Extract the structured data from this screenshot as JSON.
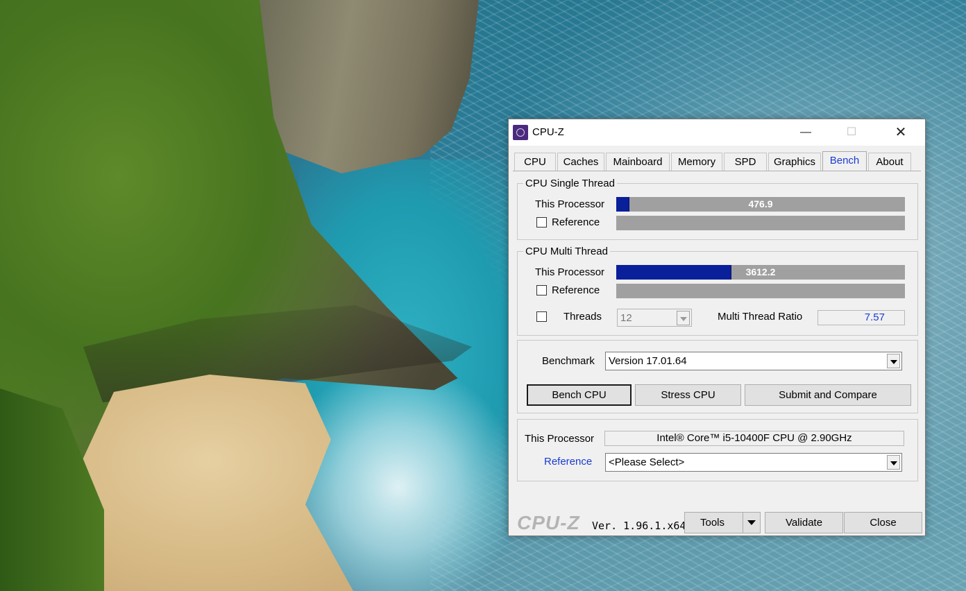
{
  "window": {
    "title": "CPU-Z",
    "controls": {
      "minimize": "—",
      "maximize": "☐",
      "close": "✕"
    }
  },
  "tabs": [
    "CPU",
    "Caches",
    "Mainboard",
    "Memory",
    "SPD",
    "Graphics",
    "Bench",
    "About"
  ],
  "active_tab": "Bench",
  "single_thread": {
    "title": "CPU Single Thread",
    "this_label": "This Processor",
    "this_score": "476.9",
    "this_fill_fraction": 0.046,
    "ref_label": "Reference",
    "ref_checked": false
  },
  "multi_thread": {
    "title": "CPU Multi Thread",
    "this_label": "This Processor",
    "this_score": "3612.2",
    "this_fill_fraction": 0.4,
    "ref_label": "Reference",
    "ref_checked": false,
    "threads_label": "Threads",
    "threads_checked": false,
    "threads_value": "12",
    "ratio_label": "Multi Thread Ratio",
    "ratio_value": "7.57"
  },
  "benchmark": {
    "label": "Benchmark",
    "version": "Version 17.01.64",
    "bench_cpu": "Bench CPU",
    "stress_cpu": "Stress CPU",
    "submit": "Submit and Compare"
  },
  "processor": {
    "this_label": "This Processor",
    "this_value": "Intel® Core™ i5-10400F CPU @ 2.90GHz",
    "ref_label": "Reference",
    "ref_value": "<Please Select>"
  },
  "footer": {
    "logo": "CPU-Z",
    "version": "Ver. 1.96.1.x64",
    "tools": "Tools",
    "validate": "Validate",
    "close": "Close"
  },
  "colors": {
    "accent_link": "#1a3bd1",
    "bar_fill": "#0a1f9a",
    "bar_bg": "#a0a0a0",
    "ratio_text": "#1a3bd1"
  }
}
